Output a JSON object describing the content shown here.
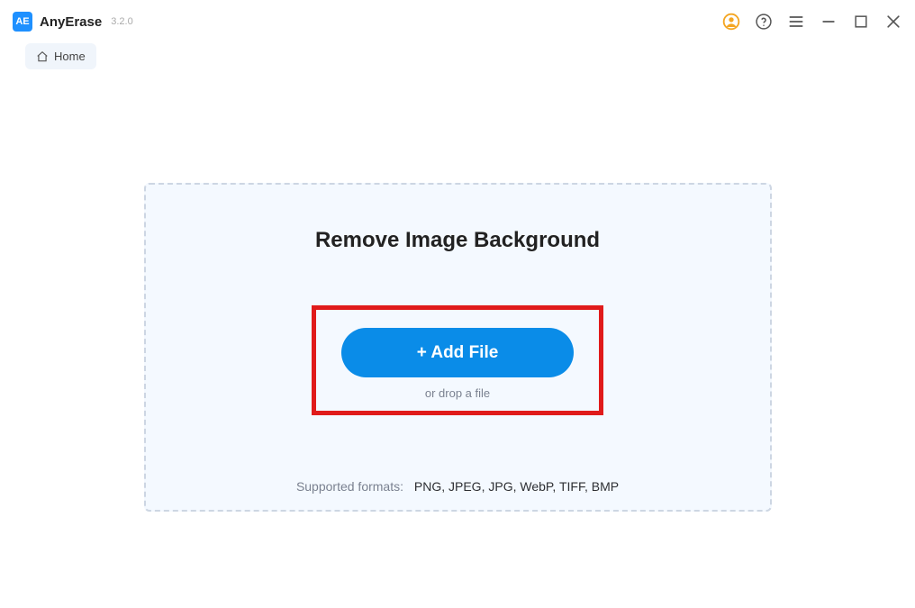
{
  "app": {
    "logo_text": "AE",
    "name": "AnyErase",
    "version": "3.2.0"
  },
  "breadcrumb": {
    "home_label": "Home"
  },
  "panel": {
    "title": "Remove Image Background",
    "add_file_label": "+ Add File",
    "drop_hint": "or drop a file",
    "formats_label": "Supported formats:",
    "formats_list": "PNG, JPEG, JPG, WebP, TIFF, BMP"
  },
  "colors": {
    "accent": "#0a8ce8",
    "highlight": "#e01b1b",
    "account": "#f4a623"
  }
}
